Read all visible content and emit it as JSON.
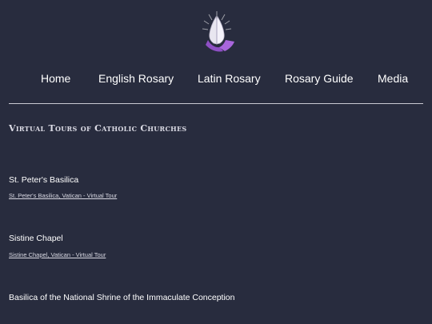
{
  "header": {
    "logo_icon": "praying-hands-icon",
    "accent_color": "#8e4fc4"
  },
  "nav": {
    "items": [
      {
        "label": "Home"
      },
      {
        "label": "English Rosary"
      },
      {
        "label": "Latin Rosary"
      },
      {
        "label": "Rosary Guide"
      },
      {
        "label": "Media"
      }
    ]
  },
  "main": {
    "section_title": "Virtual Tours of Catholic Churches",
    "churches": [
      {
        "name": "St. Peter's Basilica",
        "link": "St. Peter's Basilica, Vatican - Virtual Tour"
      },
      {
        "name": "Sistine Chapel",
        "link": "Sistine Chapel, Vatican - Virtual Tour"
      },
      {
        "name": "Basilica of the National Shrine of the Immaculate Conception"
      }
    ]
  }
}
